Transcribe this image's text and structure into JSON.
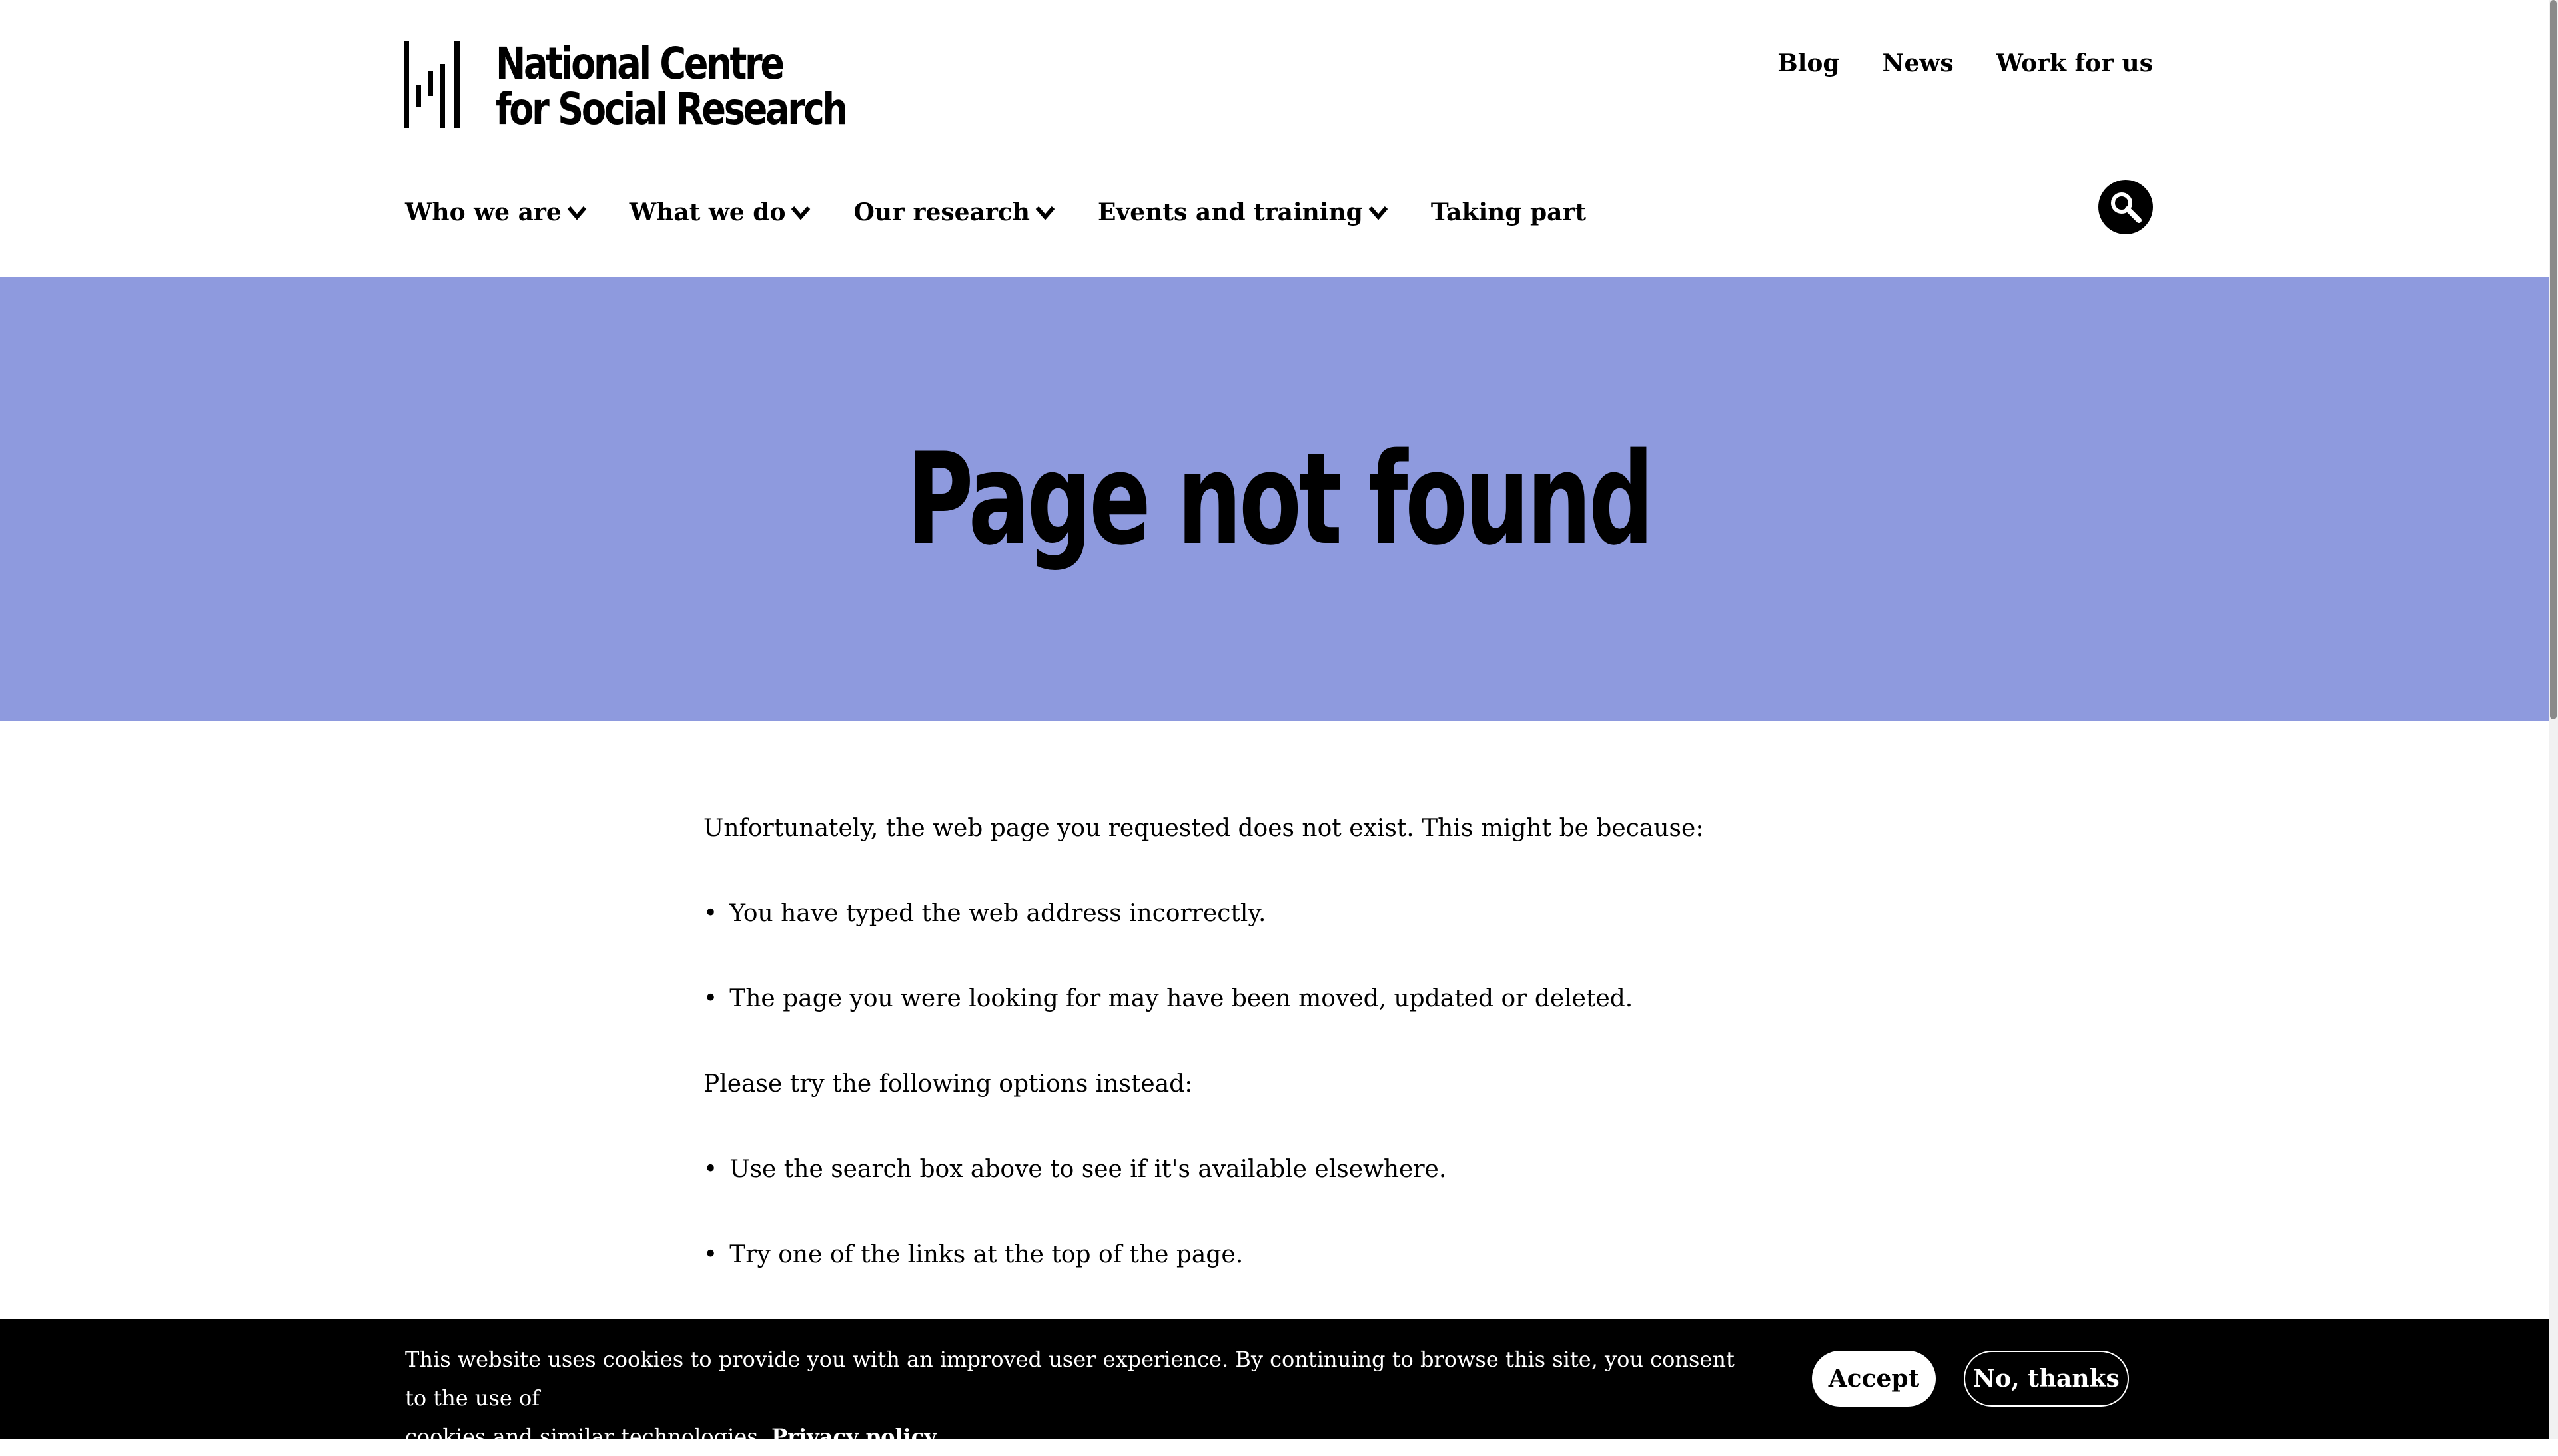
{
  "brand": {
    "name_line1": "National Centre",
    "name_line2": "for Social Research"
  },
  "top_links": [
    {
      "label": "Blog"
    },
    {
      "label": "News"
    },
    {
      "label": "Work for us"
    }
  ],
  "main_nav": [
    {
      "label": "Who we are",
      "has_dropdown": true
    },
    {
      "label": "What we do",
      "has_dropdown": true
    },
    {
      "label": "Our research",
      "has_dropdown": true
    },
    {
      "label": "Events and training",
      "has_dropdown": true
    },
    {
      "label": "Taking part",
      "has_dropdown": false
    }
  ],
  "search": {
    "icon": "search-icon"
  },
  "hero": {
    "title": "Page not found",
    "background": "#8e9ade"
  },
  "content": {
    "intro": "Unfortunately, the web page you requested does not exist. This might be because:",
    "reasons": [
      "You have typed the web address incorrectly.",
      "The page you were looking for may have been moved, updated or deleted."
    ],
    "options_intro": "Please try the following options instead:",
    "options": [
      "Use the search box above to see if it's available elsewhere.",
      "Try one of the links at the top of the page."
    ],
    "bullet": "•"
  },
  "cookie_banner": {
    "text_line1": "This website uses cookies to provide you with an improved user experience. By continuing to browse this site, you consent to the use of",
    "text_line2": "cookies and similar technologies.",
    "privacy_link": "Privacy policy",
    "accept_label": "Accept",
    "decline_label": "No, thanks"
  }
}
